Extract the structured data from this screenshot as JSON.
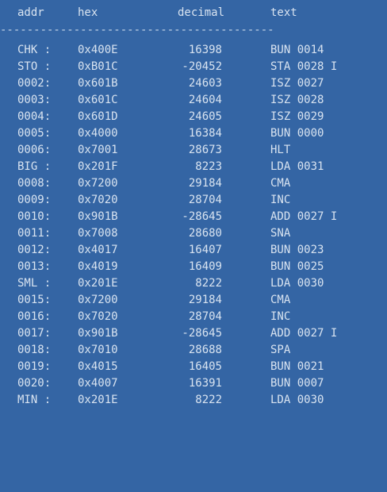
{
  "header": {
    "addr": "addr",
    "hex": "hex",
    "decimal": "decimal",
    "text": "text"
  },
  "divider": "-----------------------------------------",
  "rows": [
    {
      "addr": "CHK :",
      "hex": "0x400E",
      "decimal": "16398",
      "text": "BUN 0014"
    },
    {
      "addr": "STO :",
      "hex": "0xB01C",
      "decimal": "-20452",
      "text": "STA 0028 I"
    },
    {
      "addr": "0002:",
      "hex": "0x601B",
      "decimal": "24603",
      "text": "ISZ 0027"
    },
    {
      "addr": "0003:",
      "hex": "0x601C",
      "decimal": "24604",
      "text": "ISZ 0028"
    },
    {
      "addr": "0004:",
      "hex": "0x601D",
      "decimal": "24605",
      "text": "ISZ 0029"
    },
    {
      "addr": "0005:",
      "hex": "0x4000",
      "decimal": "16384",
      "text": "BUN 0000"
    },
    {
      "addr": "0006:",
      "hex": "0x7001",
      "decimal": "28673",
      "text": "HLT"
    },
    {
      "addr": "BIG :",
      "hex": "0x201F",
      "decimal": "8223",
      "text": "LDA 0031"
    },
    {
      "addr": "0008:",
      "hex": "0x7200",
      "decimal": "29184",
      "text": "CMA"
    },
    {
      "addr": "0009:",
      "hex": "0x7020",
      "decimal": "28704",
      "text": "INC"
    },
    {
      "addr": "0010:",
      "hex": "0x901B",
      "decimal": "-28645",
      "text": "ADD 0027 I"
    },
    {
      "addr": "0011:",
      "hex": "0x7008",
      "decimal": "28680",
      "text": "SNA"
    },
    {
      "addr": "0012:",
      "hex": "0x4017",
      "decimal": "16407",
      "text": "BUN 0023"
    },
    {
      "addr": "0013:",
      "hex": "0x4019",
      "decimal": "16409",
      "text": "BUN 0025"
    },
    {
      "addr": "SML :",
      "hex": "0x201E",
      "decimal": "8222",
      "text": "LDA 0030"
    },
    {
      "addr": "0015:",
      "hex": "0x7200",
      "decimal": "29184",
      "text": "CMA"
    },
    {
      "addr": "0016:",
      "hex": "0x7020",
      "decimal": "28704",
      "text": "INC"
    },
    {
      "addr": "0017:",
      "hex": "0x901B",
      "decimal": "-28645",
      "text": "ADD 0027 I"
    },
    {
      "addr": "0018:",
      "hex": "0x7010",
      "decimal": "28688",
      "text": "SPA"
    },
    {
      "addr": "0019:",
      "hex": "0x4015",
      "decimal": "16405",
      "text": "BUN 0021"
    },
    {
      "addr": "0020:",
      "hex": "0x4007",
      "decimal": "16391",
      "text": "BUN 0007"
    },
    {
      "addr": "MIN :",
      "hex": "0x201E",
      "decimal": "8222",
      "text": "LDA 0030"
    }
  ]
}
